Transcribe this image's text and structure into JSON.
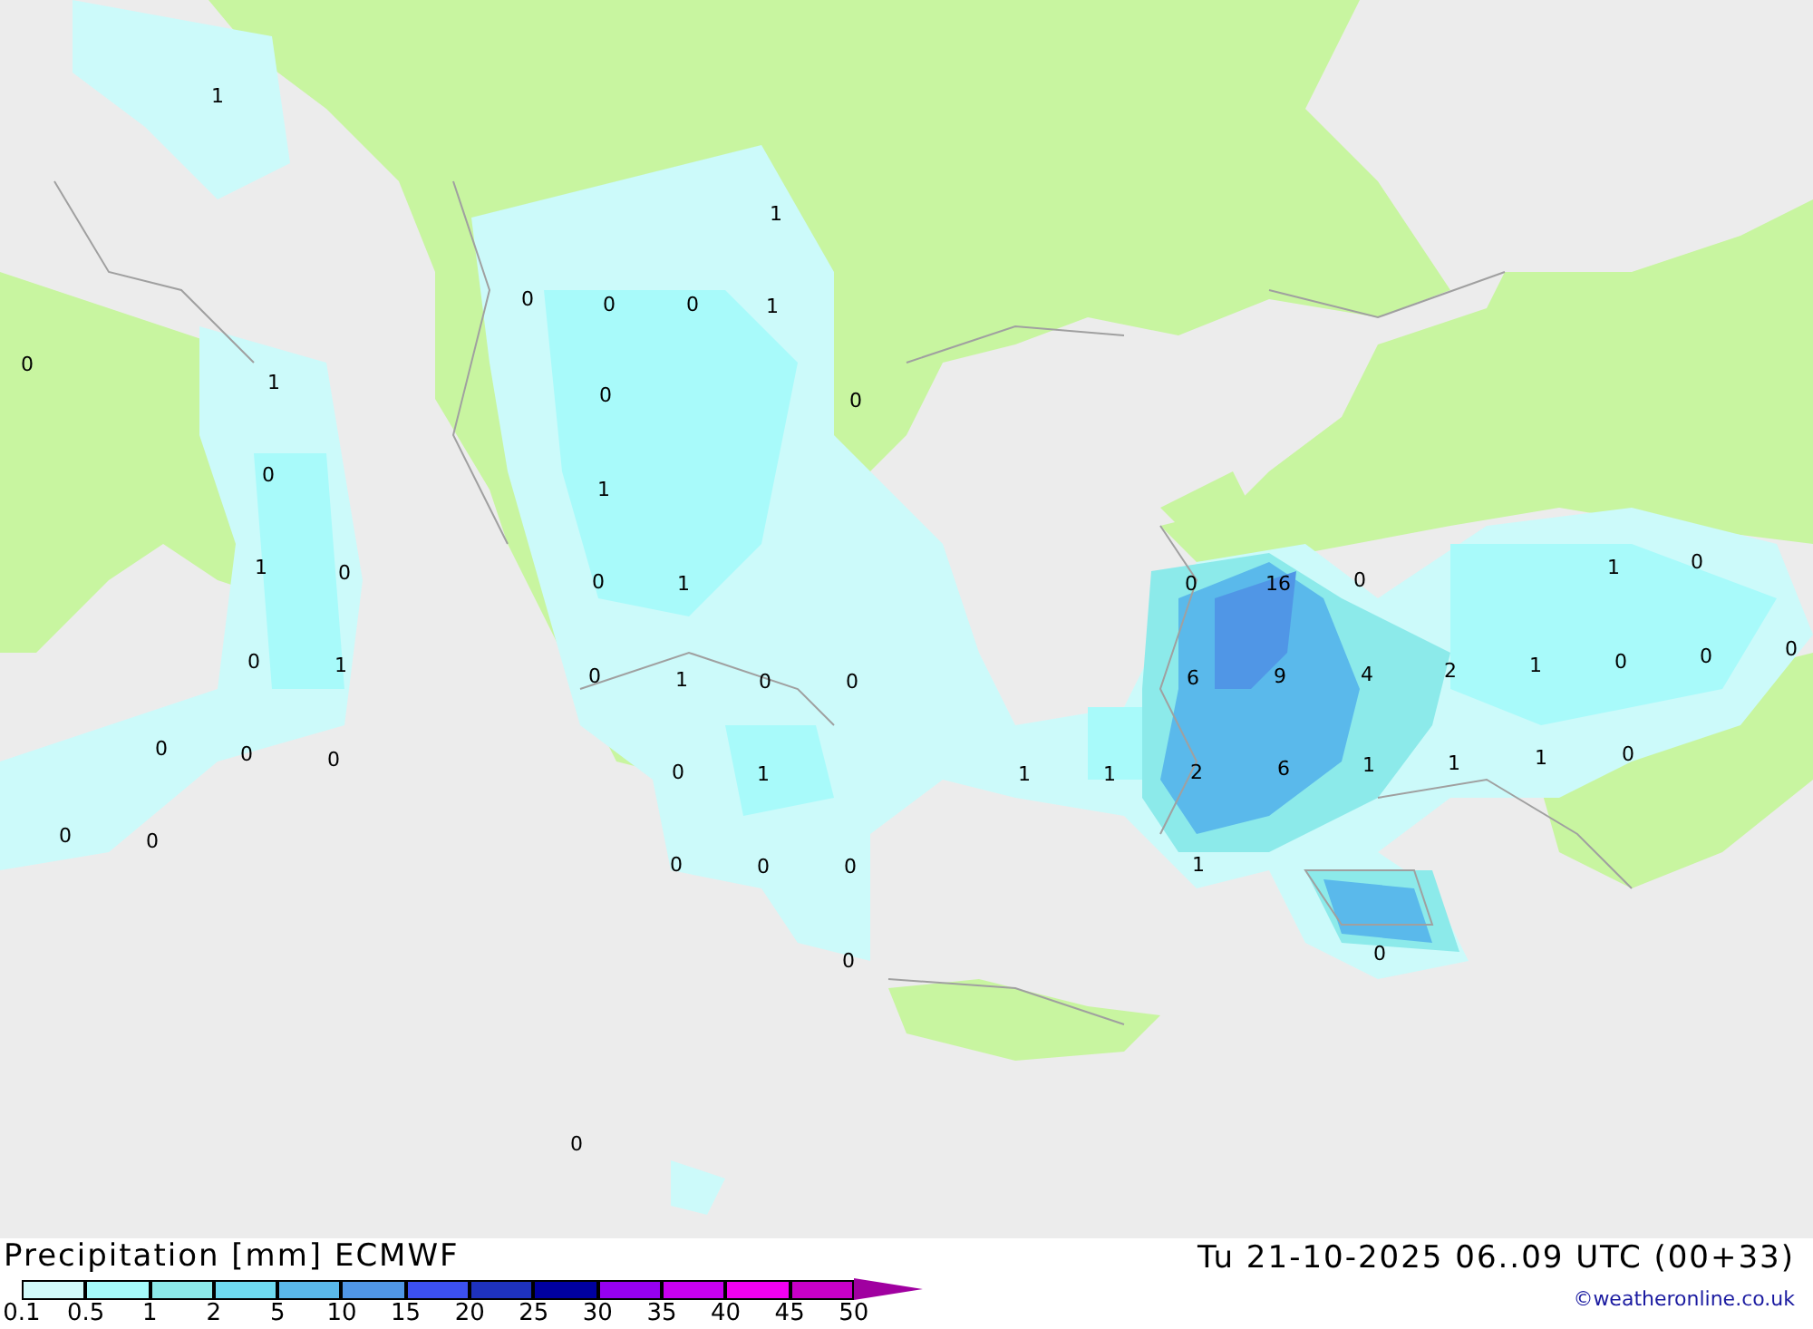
{
  "map": {
    "labels": [
      "1",
      "1",
      "0",
      "0",
      "0",
      "1",
      "0",
      "1",
      "0",
      "0",
      "0",
      "1",
      "1",
      "0",
      "0",
      "1",
      "0",
      "16",
      "0",
      "1",
      "0",
      "0",
      "1",
      "0",
      "1",
      "0",
      "0",
      "6",
      "9",
      "4",
      "2",
      "1",
      "0",
      "0",
      "0",
      "0",
      "0",
      "0",
      "0",
      "1",
      "1",
      "1",
      "2",
      "6",
      "1",
      "1",
      "1",
      "0",
      "0",
      "0",
      "0",
      "0",
      "0",
      "1",
      "0",
      "0",
      "0"
    ]
  },
  "footer": {
    "title": "Precipitation [mm] ECMWF",
    "datetime": "Tu 21-10-2025 06..09 UTC (00+33)",
    "credit": "©weatheronline.co.uk",
    "legend": {
      "swatches": [
        {
          "color": "#d2fafa"
        },
        {
          "color": "#a5fafa"
        },
        {
          "color": "#8ceaea"
        },
        {
          "color": "#6edaf0"
        },
        {
          "color": "#5ab9eb"
        },
        {
          "color": "#5096e6"
        },
        {
          "color": "#3c50f0"
        },
        {
          "color": "#1e32be"
        },
        {
          "color": "#0000a0"
        },
        {
          "color": "#9600f0"
        },
        {
          "color": "#c800f0"
        },
        {
          "color": "#f000f0"
        },
        {
          "color": "#c800c8"
        }
      ],
      "arrow": {
        "color": "#a000a0"
      },
      "ticks": [
        "0.1",
        "0.5",
        "1",
        "2",
        "5",
        "10",
        "15",
        "20",
        "25",
        "30",
        "35",
        "40",
        "45",
        "50"
      ]
    }
  }
}
